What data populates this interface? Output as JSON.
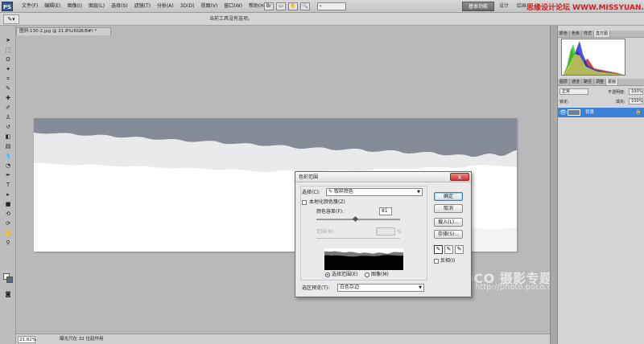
{
  "menubar": {
    "app_logo": "PS",
    "menus": [
      "文件(F)",
      "编辑(E)",
      "图像(I)",
      "图层(L)",
      "选择(S)",
      "滤镜(T)",
      "分析(A)",
      "3D(D)",
      "视图(V)",
      "窗口(W)",
      "帮助(H)"
    ],
    "workspace": "基本功能",
    "design": "设计",
    "paint": "绘画",
    "cs_live": "CS Live",
    "watermark": "思缘设计论坛 WWW.MISSYUAN.COM"
  },
  "options": {
    "message": "当前工具没有选项。"
  },
  "document": {
    "tab_title": "图例-130-2.jpg @ 21.8%(RGB/8#) *"
  },
  "statusbar": {
    "zoom": "21.82%",
    "info": "曝光只在 32 位起作用"
  },
  "panels": {
    "histogram_tabs": [
      "颜色",
      "色板",
      "样式",
      "直方图"
    ],
    "layer_tabs": [
      "图层",
      "通道",
      "路径",
      "调整",
      "蒙版"
    ],
    "blend_mode": "正常",
    "opacity_label": "不透明度:",
    "opacity": "100%",
    "lock_label": "锁定:",
    "fill_label": "填充:",
    "fill": "100%",
    "layer_name": "背景"
  },
  "watermark_poco": {
    "title": "POCO 摄影专题",
    "url": "http://photo.poco.cn/"
  },
  "dialog": {
    "title": "色彩范围",
    "select_label": "选择(C):",
    "select_value": "取样颜色",
    "localized_label": "本地化颜色簇(Z)",
    "fuzziness_label": "颜色容差(F):",
    "fuzziness_value": "81",
    "range_label": "范围(R):",
    "range_unit": "%",
    "radio_selection": "选择范围(E)",
    "radio_image": "图像(M)",
    "selection_preview_label": "选区预览(T):",
    "selection_preview_value": "白色杂边",
    "ok": "确定",
    "cancel": "取消",
    "load": "载入(L)...",
    "save": "存储(S)...",
    "invert": "反相(I)",
    "close": "X"
  }
}
